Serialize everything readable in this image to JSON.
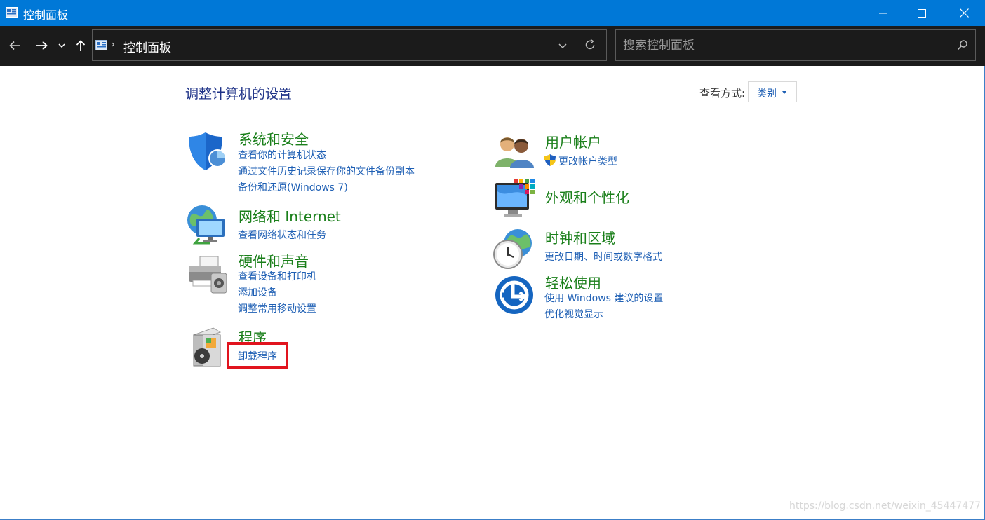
{
  "window": {
    "title": "控制面板"
  },
  "address_bar": {
    "breadcrumb": "控制面板"
  },
  "search": {
    "placeholder": "搜索控制面板"
  },
  "header": {
    "title": "调整计算机的设置",
    "view_by_label": "查看方式:",
    "view_by_value": "类别"
  },
  "categories": {
    "system_security": {
      "title": "系统和安全",
      "links": [
        "查看你的计算机状态",
        "通过文件历史记录保存你的文件备份副本",
        "备份和还原(Windows 7)"
      ],
      "icon": "shield-icon"
    },
    "network": {
      "title": "网络和 Internet",
      "links": [
        "查看网络状态和任务"
      ],
      "icon": "network-globe-icon"
    },
    "hardware": {
      "title": "硬件和声音",
      "links": [
        "查看设备和打印机",
        "添加设备",
        "调整常用移动设置"
      ],
      "icon": "printer-icon"
    },
    "programs": {
      "title": "程序",
      "links": [
        "卸载程序"
      ],
      "icon": "programs-icon"
    },
    "user_accounts": {
      "title": "用户帐户",
      "links": [
        "更改帐户类型"
      ],
      "icon": "users-icon"
    },
    "appearance": {
      "title": "外观和个性化",
      "links": [],
      "icon": "monitor-palette-icon"
    },
    "clock_region": {
      "title": "时钟和区域",
      "links": [
        "更改日期、时间或数字格式"
      ],
      "icon": "clock-globe-icon"
    },
    "ease_of_access": {
      "title": "轻松使用",
      "links": [
        "使用 Windows 建议的设置",
        "优化视觉显示"
      ],
      "icon": "ease-of-access-icon"
    }
  },
  "watermark": "https://blog.csdn.net/weixin_45447477",
  "colors": {
    "titlebar": "#0078d7",
    "navbar": "#1b1b1b",
    "category_title": "#1a7f1a",
    "link": "#1e5fb4",
    "highlight": "#e1141e"
  }
}
